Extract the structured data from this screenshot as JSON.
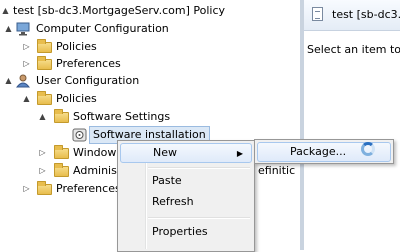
{
  "tree": {
    "root_label": "test [sb-dc3.MortgageServ.com] Policy",
    "computer_config": "Computer Configuration",
    "cc_policies": "Policies",
    "cc_preferences": "Preferences",
    "user_config": "User Configuration",
    "uc_policies": "Policies",
    "software_settings": "Software Settings",
    "software_installation": "Software installation",
    "windows_partial": "Window",
    "admin_partial": "Adminis",
    "admin_trailing": "efinitic",
    "uc_preferences": "Preferences"
  },
  "right_pane": {
    "title": "test [sb-dc3.",
    "message": "Select an item to v"
  },
  "context_menu": {
    "new": "New",
    "paste": "Paste",
    "refresh": "Refresh",
    "properties": "Properties"
  },
  "submenu": {
    "package": "Package..."
  },
  "icons": {
    "expanded": "▲",
    "collapsed": "▷",
    "submenu_arrow": "▶"
  }
}
